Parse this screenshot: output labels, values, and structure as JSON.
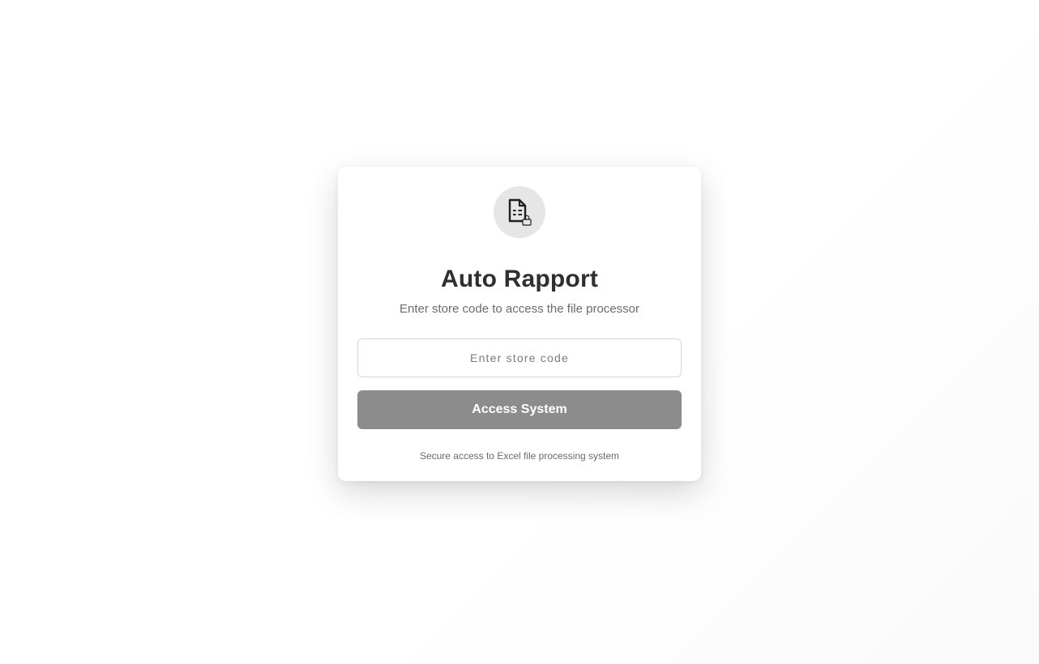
{
  "login": {
    "logo_icon": "spreadsheet-file-lock-icon",
    "title": "Auto Rapport",
    "subtitle": "Enter store code to access the file processor",
    "store_code": {
      "value": "",
      "placeholder": "Enter store code"
    },
    "submit_label": "Access System",
    "footnote": "Secure access to Excel file processing system"
  },
  "colors": {
    "button_bg": "#8c8c8c",
    "logo_bg": "#e6e6e6",
    "title": "#2f2f2f"
  }
}
